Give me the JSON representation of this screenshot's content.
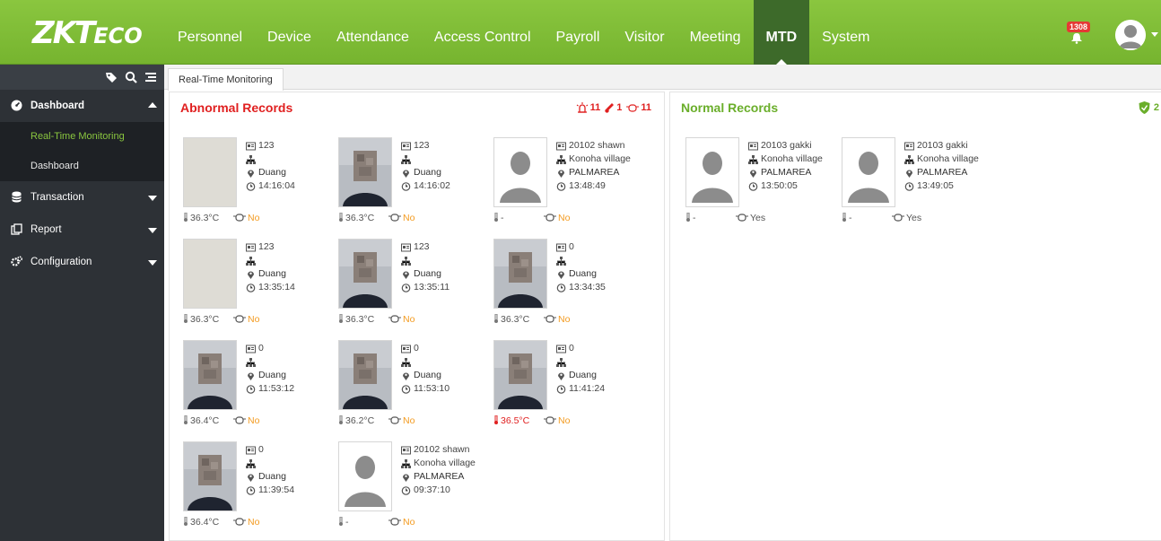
{
  "header": {
    "logo_main": "ZKT",
    "logo_small": "ECO",
    "nav": [
      "Personnel",
      "Device",
      "Attendance",
      "Access Control",
      "Payroll",
      "Visitor",
      "Meeting",
      "MTD",
      "System"
    ],
    "active_nav": "MTD",
    "notification_count": "1308"
  },
  "sidebar": {
    "items": [
      {
        "label": "Dashboard",
        "open": true,
        "children": [
          "Real-Time Monitoring",
          "Dashboard"
        ]
      },
      {
        "label": "Transaction"
      },
      {
        "label": "Report"
      },
      {
        "label": "Configuration"
      }
    ],
    "active_child": "Real-Time Monitoring"
  },
  "tabs": [
    "Real-Time Monitoring"
  ],
  "abnormal": {
    "title": "Abnormal Records",
    "alarm_count": "11",
    "temp_count": "1",
    "mask_count": "11",
    "records": [
      {
        "id": "123",
        "dept": "",
        "area": "Duang",
        "time": "14:16:04",
        "temp": "36.3°C",
        "mask": "No",
        "photo": "blank",
        "hot": false
      },
      {
        "id": "123",
        "dept": "",
        "area": "Duang",
        "time": "14:16:02",
        "temp": "36.3°C",
        "mask": "No",
        "photo": "person",
        "hot": false
      },
      {
        "id": "20102 shawn",
        "dept": "Konoha village",
        "area": "PALMAREA",
        "time": "13:48:49",
        "temp": "-",
        "mask": "No",
        "photo": "silhouette",
        "hot": false
      },
      {
        "id": "123",
        "dept": "",
        "area": "Duang",
        "time": "13:35:14",
        "temp": "36.3°C",
        "mask": "No",
        "photo": "blank",
        "hot": false
      },
      {
        "id": "123",
        "dept": "",
        "area": "Duang",
        "time": "13:35:11",
        "temp": "36.3°C",
        "mask": "No",
        "photo": "person",
        "hot": false
      },
      {
        "id": "0",
        "dept": "",
        "area": "Duang",
        "time": "13:34:35",
        "temp": "36.3°C",
        "mask": "No",
        "photo": "person",
        "hot": false
      },
      {
        "id": "0",
        "dept": "",
        "area": "Duang",
        "time": "11:53:12",
        "temp": "36.4°C",
        "mask": "No",
        "photo": "person",
        "hot": false
      },
      {
        "id": "0",
        "dept": "",
        "area": "Duang",
        "time": "11:53:10",
        "temp": "36.2°C",
        "mask": "No",
        "photo": "person",
        "hot": false
      },
      {
        "id": "0",
        "dept": "",
        "area": "Duang",
        "time": "11:41:24",
        "temp": "36.5°C",
        "mask": "No",
        "photo": "person",
        "hot": true
      },
      {
        "id": "0",
        "dept": "",
        "area": "Duang",
        "time": "11:39:54",
        "temp": "36.4°C",
        "mask": "No",
        "photo": "person",
        "hot": false
      },
      {
        "id": "20102 shawn",
        "dept": "Konoha village",
        "area": "PALMAREA",
        "time": "09:37:10",
        "temp": "-",
        "mask": "No",
        "photo": "silhouette",
        "hot": false
      }
    ]
  },
  "normal": {
    "title": "Normal Records",
    "count": "2",
    "records": [
      {
        "id": "20103 gakki",
        "dept": "Konoha village",
        "area": "PALMAREA",
        "time": "13:50:05",
        "temp": "-",
        "mask": "Yes",
        "photo": "silhouette",
        "hot": false
      },
      {
        "id": "20103 gakki",
        "dept": "Konoha village",
        "area": "PALMAREA",
        "time": "13:49:05",
        "temp": "-",
        "mask": "Yes",
        "photo": "silhouette",
        "hot": false
      }
    ]
  },
  "colors": {
    "brand_green": "#7ab933",
    "active_nav": "#3d6a2a",
    "abnormal_red": "#e02020",
    "normal_green": "#6aae2a",
    "mask_orange": "#f39a1e"
  }
}
